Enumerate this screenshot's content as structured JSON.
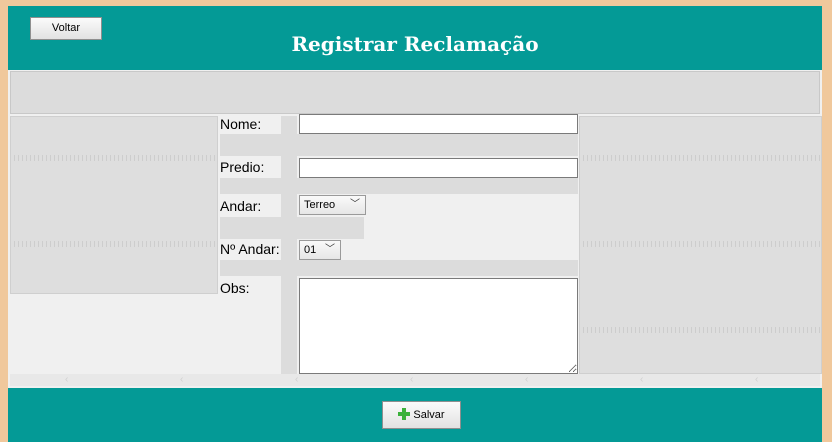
{
  "app": {
    "title": "Registrar Reclamação"
  },
  "buttons": {
    "back_label": "Voltar",
    "save_label": "Salvar"
  },
  "form": {
    "name_label": "Nome:",
    "building_label": "Predio:",
    "floor_label": "Andar:",
    "floor_value": "Terreo",
    "floor_number_label": "Nº Andar:",
    "floor_number_value": "01",
    "obs_label": "Obs:"
  },
  "colors": {
    "accent": "#049a96",
    "panel": "#dcdcdc",
    "window_border": "#f0c89c"
  },
  "icons": {
    "save": "plus-icon",
    "dropdown": "chevron-down-icon",
    "scroll": "chevron-left-icon"
  }
}
